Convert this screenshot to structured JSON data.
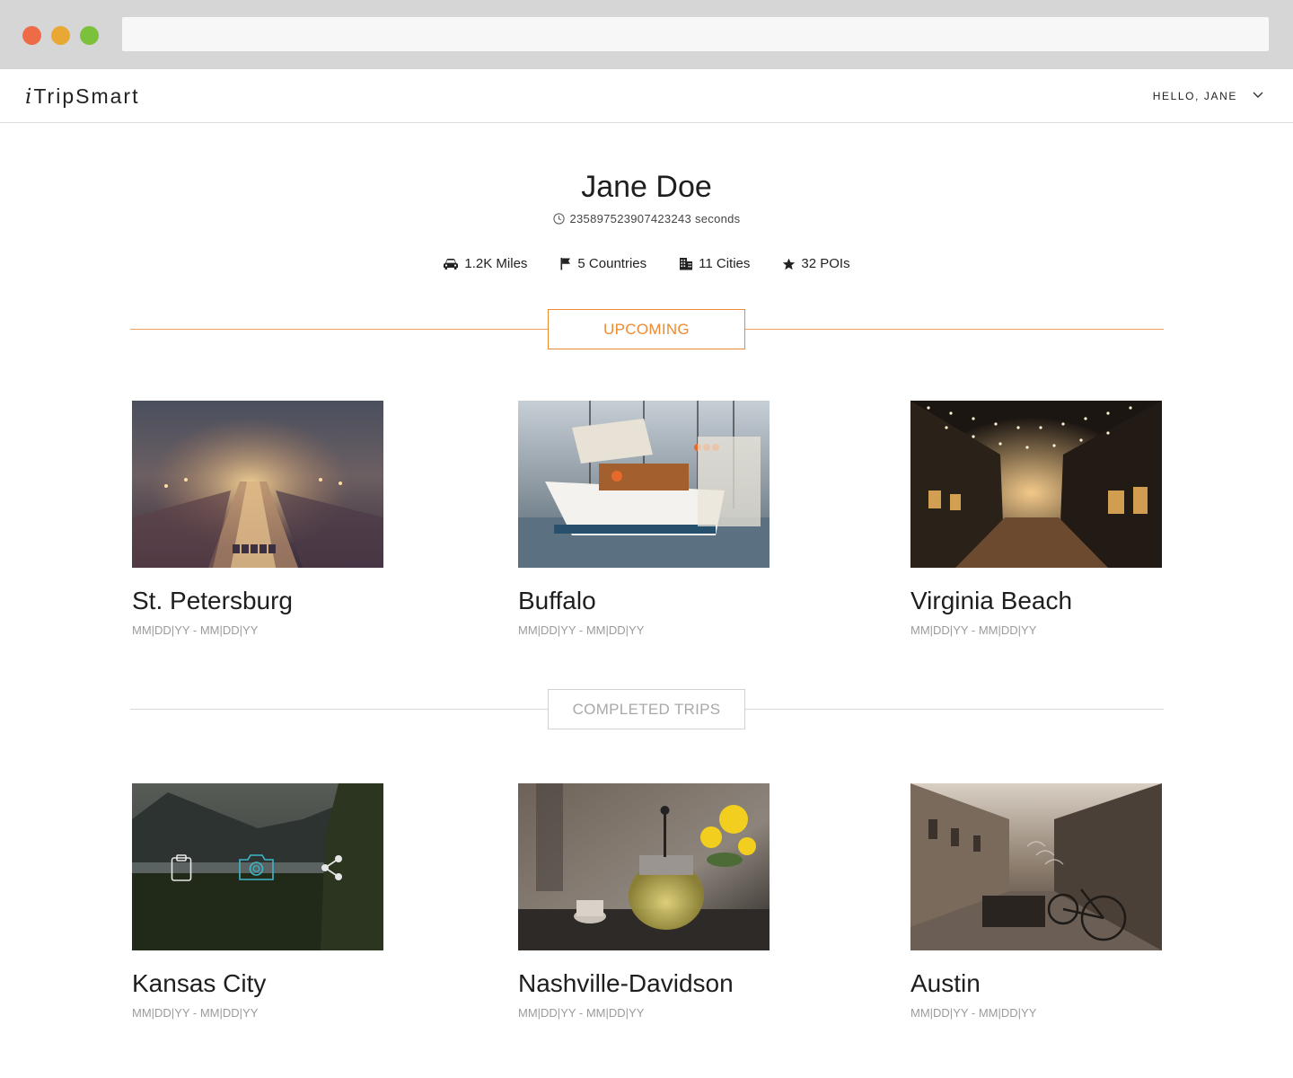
{
  "app": {
    "logo_i": "i",
    "logo_trip": "Trip",
    "logo_smart": "Smart"
  },
  "nav": {
    "greeting": "HELLO, JANE"
  },
  "profile": {
    "name": "Jane Doe",
    "duration": "235897523907423243 seconds"
  },
  "stats": [
    {
      "icon": "car-icon",
      "label": "1.2K Miles"
    },
    {
      "icon": "flag-icon",
      "label": "5 Countries"
    },
    {
      "icon": "buildings-icon",
      "label": "11 Cities"
    },
    {
      "icon": "star-icon",
      "label": "32 POIs"
    }
  ],
  "sections": {
    "upcoming": {
      "label": "UPCOMING",
      "color": "#ee8a33"
    },
    "completed": {
      "label": "COMPLETED TRIPS",
      "color": "#a8a8a8"
    }
  },
  "upcoming_trips": [
    {
      "name": "St. Petersburg",
      "dates": "MM|DD|YY - MM|DD|YY",
      "image": "foggy-railway-night"
    },
    {
      "name": "Buffalo",
      "dates": "MM|DD|YY - MM|DD|YY",
      "image": "sailboat-harbor"
    },
    {
      "name": "Virginia Beach",
      "dates": "MM|DD|YY - MM|DD|YY",
      "image": "string-lights-street"
    }
  ],
  "completed_trips": [
    {
      "name": "Kansas City",
      "dates": "MM|DD|YY - MM|DD|YY",
      "image": "lake-mountains-dusk",
      "overlay_icons": [
        "clipboard-icon",
        "camera-icon",
        "share-icon"
      ]
    },
    {
      "name": "Nashville-Davidson",
      "dates": "MM|DD|YY - MM|DD|YY",
      "image": "teapot-flowers"
    },
    {
      "name": "Austin",
      "dates": "MM|DD|YY - MM|DD|YY",
      "image": "bicycle-street"
    }
  ],
  "colors": {
    "accent": "#ee8a33",
    "camera_highlight": "#3fb5c9"
  }
}
